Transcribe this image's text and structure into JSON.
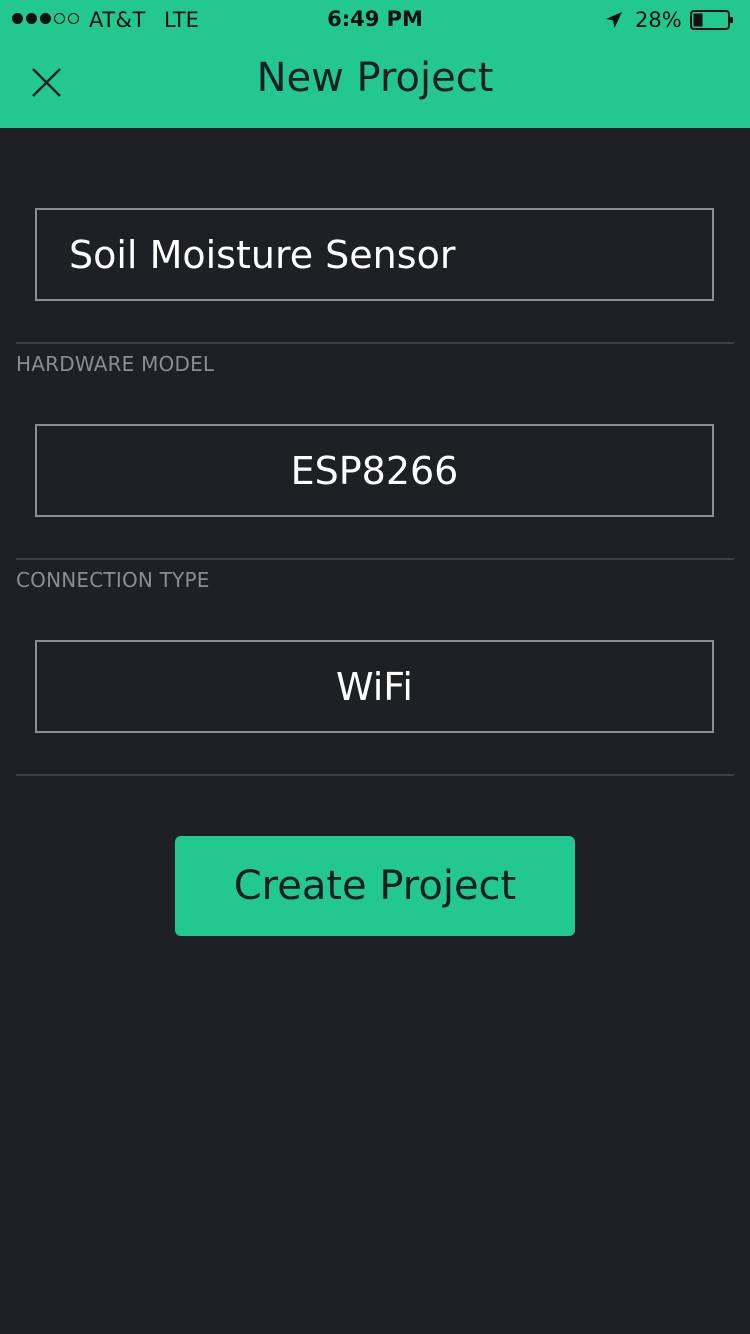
{
  "status_bar": {
    "carrier": "AT&T",
    "network": "LTE",
    "time": "6:49 PM",
    "battery": "28%"
  },
  "nav": {
    "title": "New Project",
    "close_icon": "close-icon"
  },
  "form": {
    "project_name": "Soil Moisture Sensor",
    "hardware_label": "HARDWARE MODEL",
    "hardware_value": "ESP8266",
    "connection_label": "CONNECTION TYPE",
    "connection_value": "WiFi"
  },
  "actions": {
    "create_label": "Create Project"
  },
  "colors": {
    "accent": "#23c890",
    "background": "#1f2024"
  }
}
